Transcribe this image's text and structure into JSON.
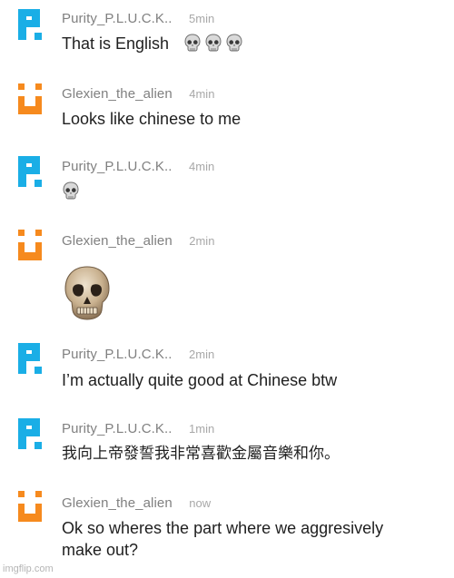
{
  "app": {
    "watermark": "imgflip.com"
  },
  "colors": {
    "purity_avatar": "#1aaee6",
    "glexien_avatar": "#f68a1e",
    "username": "#808080",
    "timestamp": "#a8a8a8",
    "body_text": "#1f1f1f"
  },
  "messages": [
    {
      "user": "Purity_P.L.U.C.K..",
      "time": "5min",
      "text": "That is English",
      "emoji": [
        "skull-icon",
        "skull-icon",
        "skull-icon"
      ]
    },
    {
      "user": "Glexien_the_alien",
      "time": "4min",
      "text": "Looks like chinese to me"
    },
    {
      "user": "Purity_P.L.U.C.K..",
      "time": "4min",
      "text": "",
      "emoji": [
        "skull-icon"
      ]
    },
    {
      "user": "Glexien_the_alien",
      "time": "2min",
      "text": "",
      "image": "skull-photo"
    },
    {
      "user": "Purity_P.L.U.C.K..",
      "time": "2min",
      "text": "I’m actually quite good at Chinese btw"
    },
    {
      "user": "Purity_P.L.U.C.K..",
      "time": "1min",
      "text": "我向上帝發誓我非常喜歡金屬音樂和你。"
    },
    {
      "user": "Glexien_the_alien",
      "time": "now",
      "text": "Ok so wheres the part where we aggresively",
      "text2": "make out?"
    }
  ]
}
